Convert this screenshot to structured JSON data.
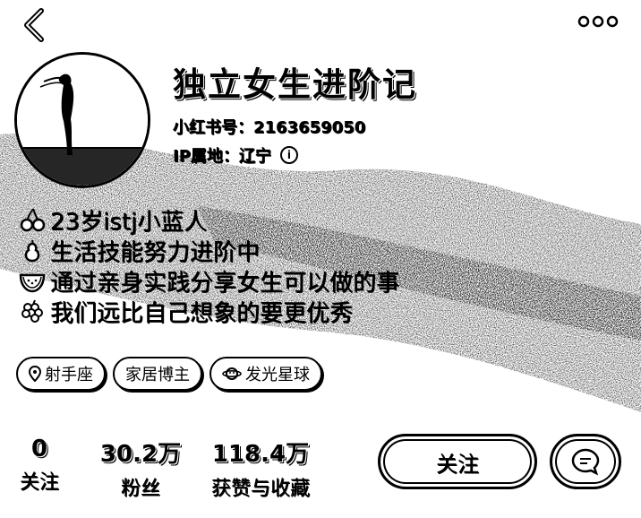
{
  "profile": {
    "nickname": "独立女生进阶记",
    "red_id": "小红书号：2163659050",
    "ip_location": "IP属地：辽宁"
  },
  "bio": [
    {
      "icon": "cherries-icon",
      "text": "23岁istj小蓝人"
    },
    {
      "icon": "pear-icon",
      "text": "生活技能努力进阶中"
    },
    {
      "icon": "watermelon-icon",
      "text": "通过亲身实践分享女生可以做的事"
    },
    {
      "icon": "grapes-icon",
      "text": "我们远比自己想象的要更优秀"
    }
  ],
  "tags": [
    {
      "icon": "location-pin-icon",
      "label": "射手座"
    },
    {
      "icon": "",
      "label": "家居博主"
    },
    {
      "icon": "planet-icon",
      "label": "发光星球"
    }
  ],
  "stats": [
    {
      "value": "0",
      "label": "关注"
    },
    {
      "value": "30.2万",
      "label": "粉丝"
    },
    {
      "value": "118.4万",
      "label": "获赞与收藏"
    }
  ],
  "actions": {
    "follow_label": "关注"
  }
}
